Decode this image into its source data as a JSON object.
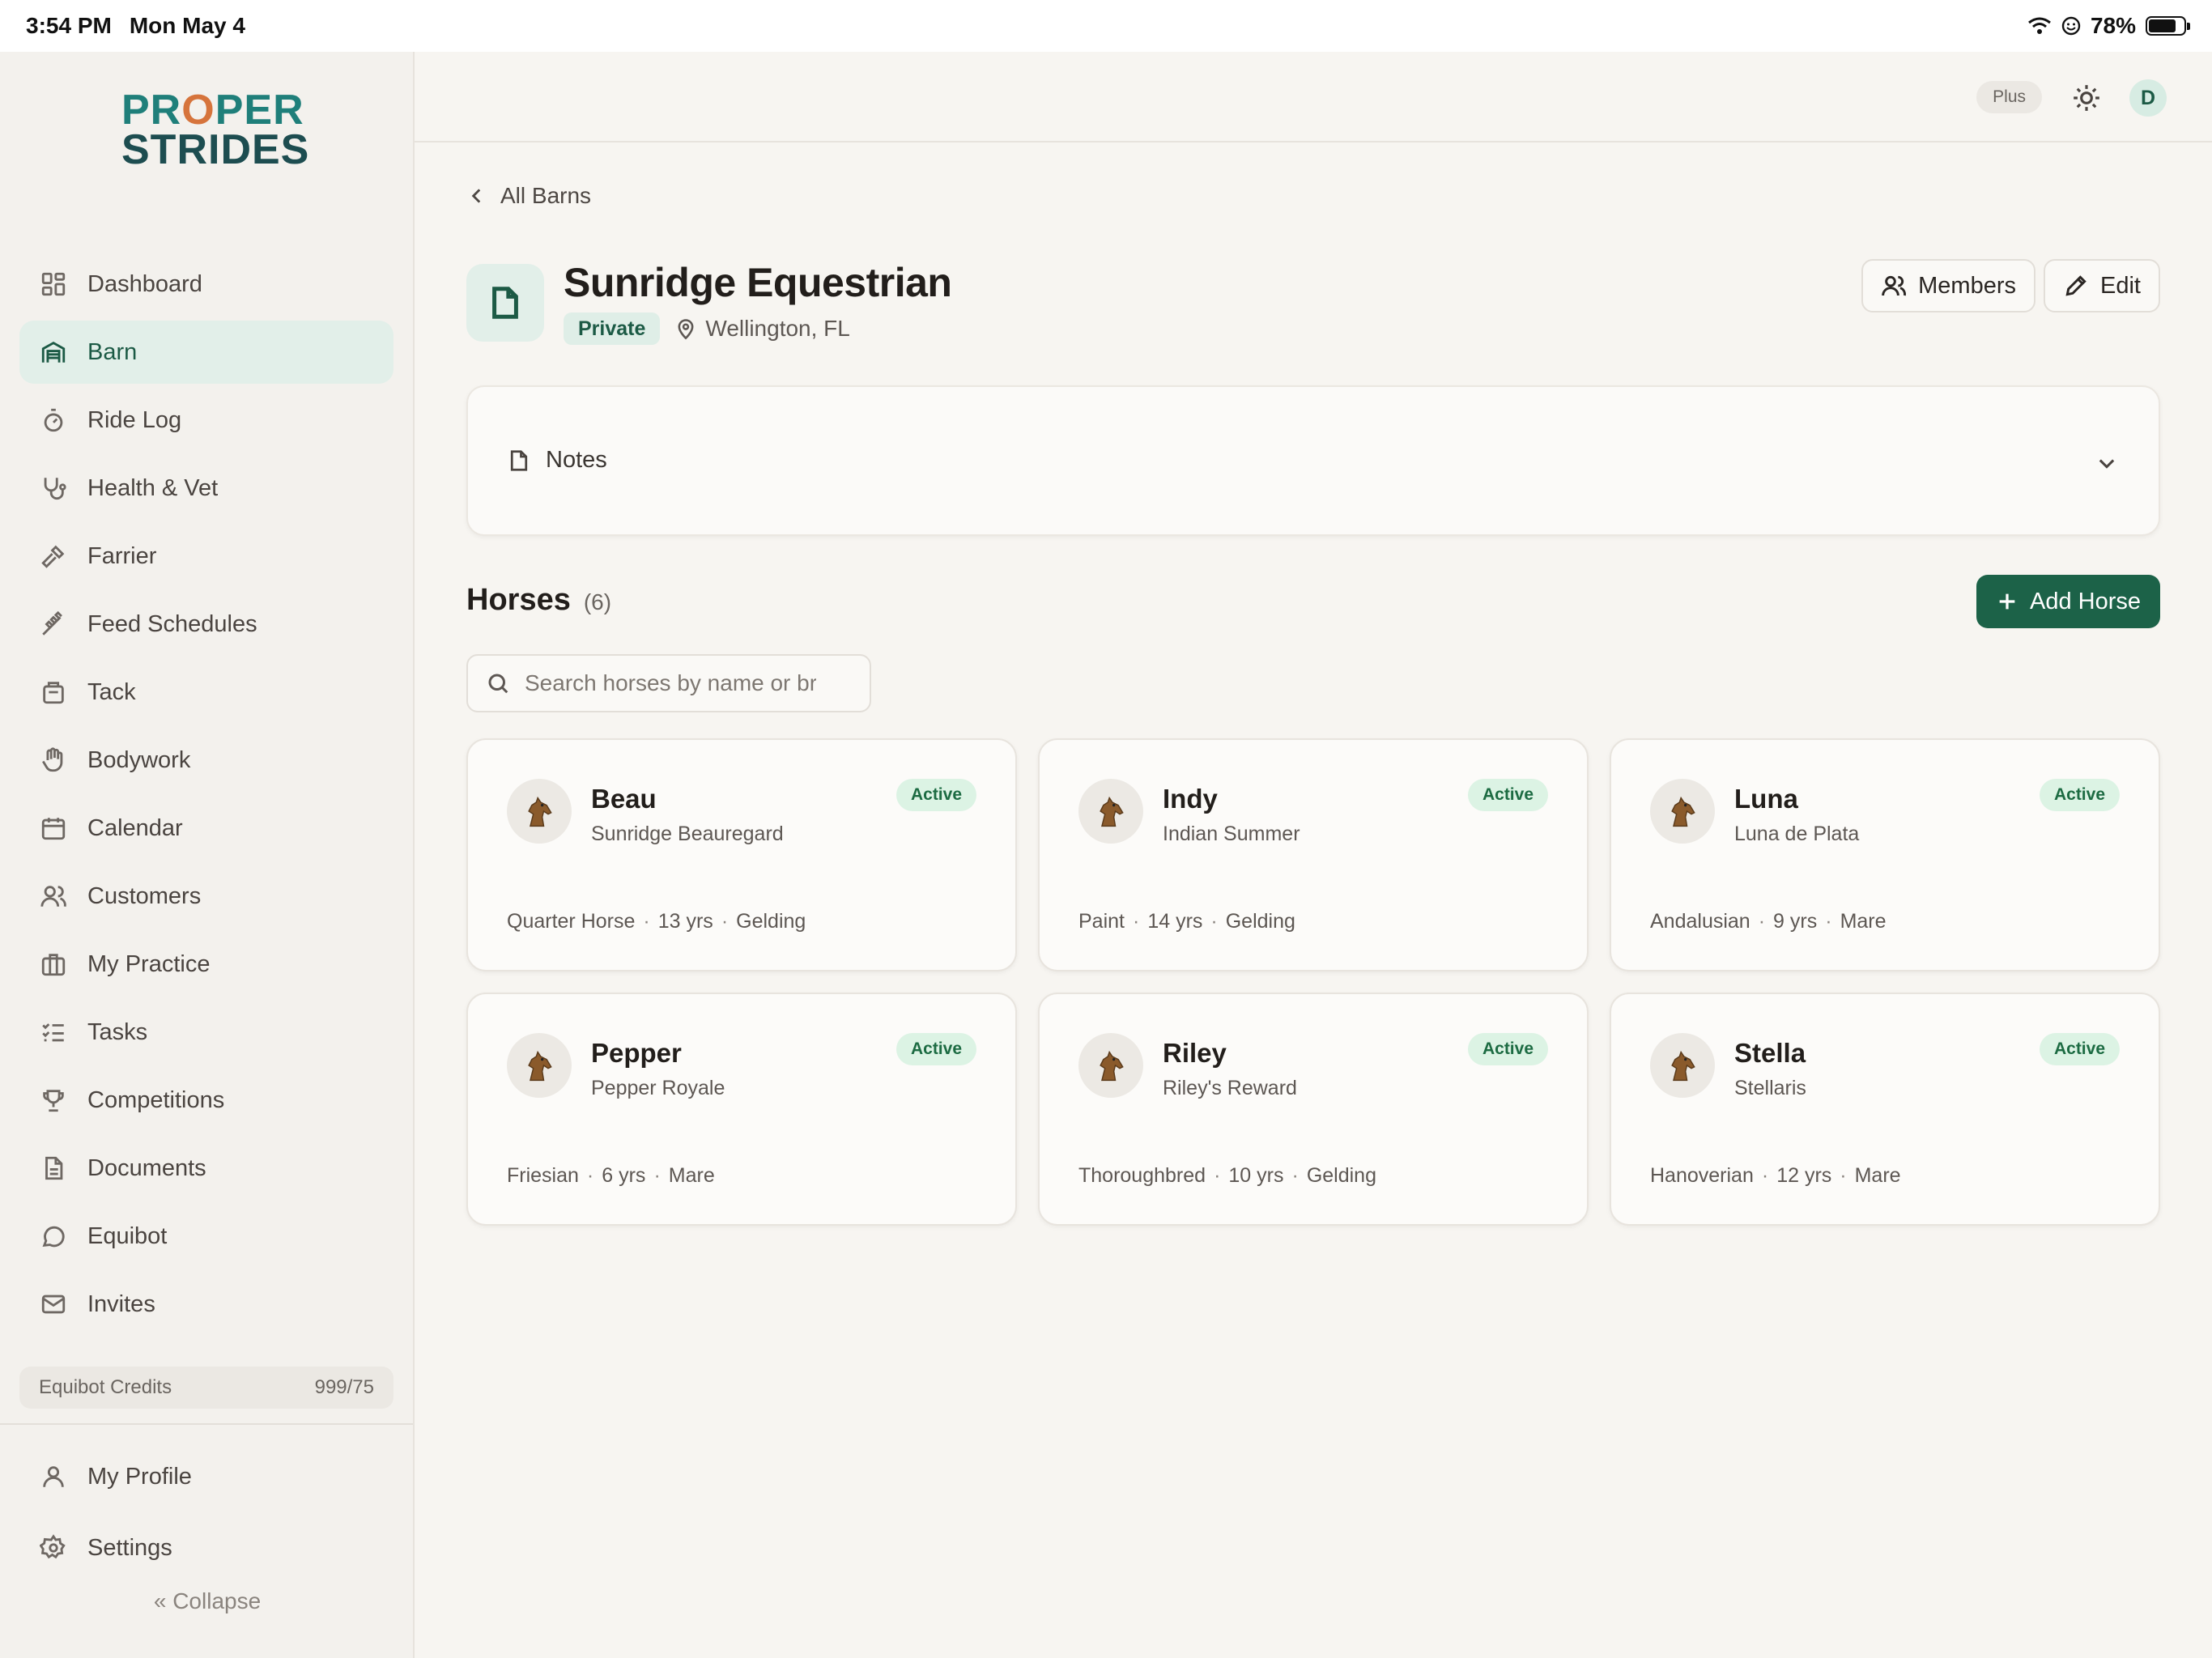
{
  "status_bar": {
    "time": "3:54 PM",
    "date": "Mon May 4",
    "battery": "78%",
    "battery_level": 0.78
  },
  "brand": {
    "line1_a": "PR",
    "line1_o": "O",
    "line1_b": "PER",
    "line2": "STRIDES"
  },
  "sidebar": {
    "items": [
      {
        "label": "Dashboard",
        "icon": "dashboard-icon"
      },
      {
        "label": "Barn",
        "icon": "barn-icon",
        "active": true
      },
      {
        "label": "Ride Log",
        "icon": "stopwatch-icon"
      },
      {
        "label": "Health & Vet",
        "icon": "stethoscope-icon"
      },
      {
        "label": "Farrier",
        "icon": "hammer-icon"
      },
      {
        "label": "Feed Schedules",
        "icon": "wheat-icon"
      },
      {
        "label": "Tack",
        "icon": "saddle-icon"
      },
      {
        "label": "Bodywork",
        "icon": "hand-icon"
      },
      {
        "label": "Calendar",
        "icon": "calendar-icon"
      },
      {
        "label": "Customers",
        "icon": "users-icon"
      },
      {
        "label": "My Practice",
        "icon": "briefcase-icon"
      },
      {
        "label": "Tasks",
        "icon": "list-check-icon"
      },
      {
        "label": "Competitions",
        "icon": "trophy-icon"
      },
      {
        "label": "Documents",
        "icon": "document-icon"
      },
      {
        "label": "Equibot",
        "icon": "chat-icon"
      },
      {
        "label": "Invites",
        "icon": "mail-icon"
      }
    ],
    "credits_label": "Equibot Credits",
    "credits_value": "999/75",
    "bottom_items": [
      {
        "label": "My Profile",
        "icon": "user-icon"
      },
      {
        "label": "Settings",
        "icon": "gear-icon"
      }
    ],
    "collapse_label": "Collapse"
  },
  "topbar": {
    "plan_badge": "Plus",
    "avatar_initial": "D"
  },
  "page": {
    "back_label": "All Barns",
    "title": "Sunridge Equestrian",
    "visibility": "Private",
    "location": "Wellington, FL",
    "members_label": "Members",
    "edit_label": "Edit",
    "notes_label": "Notes",
    "horses_title": "Horses",
    "horses_count": "(6)",
    "add_horse_label": "Add Horse",
    "search_placeholder": "Search horses by name or breed"
  },
  "horses": [
    {
      "name": "Beau",
      "full_name": "Sunridge Beauregard",
      "status": "Active",
      "breed": "Quarter Horse",
      "age": "13 yrs",
      "sex": "Gelding"
    },
    {
      "name": "Indy",
      "full_name": "Indian Summer",
      "status": "Active",
      "breed": "Paint",
      "age": "14 yrs",
      "sex": "Gelding"
    },
    {
      "name": "Luna",
      "full_name": "Luna de Plata",
      "status": "Active",
      "breed": "Andalusian",
      "age": "9 yrs",
      "sex": "Mare"
    },
    {
      "name": "Pepper",
      "full_name": "Pepper Royale",
      "status": "Active",
      "breed": "Friesian",
      "age": "6 yrs",
      "sex": "Mare"
    },
    {
      "name": "Riley",
      "full_name": "Riley's Reward",
      "status": "Active",
      "breed": "Thoroughbred",
      "age": "10 yrs",
      "sex": "Gelding"
    },
    {
      "name": "Stella",
      "full_name": "Stellaris",
      "status": "Active",
      "breed": "Hanoverian",
      "age": "12 yrs",
      "sex": "Mare"
    }
  ],
  "colors": {
    "accent": "#1c6248",
    "active_bg": "#e2efe9",
    "badge_bg": "#dcf3e4"
  }
}
